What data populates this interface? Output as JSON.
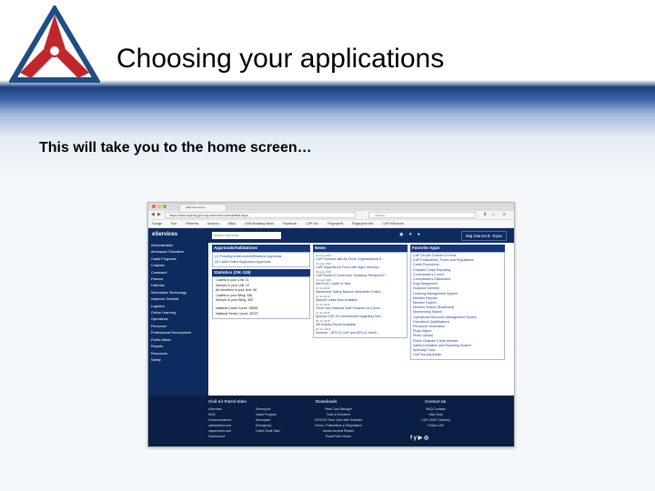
{
  "slide": {
    "title": "Choosing your applications",
    "subtitle": "This will take you to the home screen…"
  },
  "browser": {
    "tab_title": "eServices home",
    "url": "https://www.capnhq.gov/cap.eservices.web/default.aspx",
    "search_placeholder": "Search",
    "bookmarks": [
      "Google",
      "Box",
      "Pinterest",
      "Amazon",
      "eBay",
      "CNN Breaking News",
      "Facebook",
      "CAP Info",
      "Fingerprint",
      "Fingerprint Info",
      "CAP eServices"
    ]
  },
  "header": {
    "brand": "eServices",
    "search_placeholder": "Search eServices",
    "user": "Maj Dianna E. Ryan"
  },
  "sidebar": {
    "items": [
      "Administration",
      "Aerospace Education",
      "Cadet Programs",
      "Chaplain",
      "Command",
      "Finance",
      "Historian",
      "Information Technology",
      "Inspector General",
      "Logistics",
      "Online Learning",
      "Operations",
      "Personnel",
      "Professional Development",
      "Public Affairs",
      "Reports",
      "Resources",
      "Safety"
    ]
  },
  "approvals": {
    "title": "Approvals/Validations",
    "links": [
      "(1) Pending Achievement/Milestone Approvals",
      "(0) Cadet Online Application Approvals"
    ]
  },
  "statistics": {
    "title": "Statistics (OK-115)",
    "lines": [
      "Cadets in your Unit: 21",
      "Seniors in your Unit: 37",
      "All members in your Unit: 58",
      "Cadets in your Wing: 346",
      "Seniors in your Wing: 492"
    ],
    "national": [
      "National Cadet Count: 25835",
      "National Senior Count: 32237"
    ]
  },
  "news": {
    "title": "News",
    "items": [
      {
        "date": "14 Aug 2018",
        "title": "CAP Honored with Air Force Organizational E..."
      },
      {
        "date": "13 Aug 2018",
        "title": "CAP Supports Air Force with flight intercept..."
      },
      {
        "date": "09 Aug 2018",
        "title": "CAP Board of Governors' Guidance Renamed F..."
      },
      {
        "date": "01 Aug 2018",
        "title": "MAYS AC Cadet of Year"
      },
      {
        "date": "31 Jul 2018",
        "title": "September Safety Beacon Newsletter Online..."
      },
      {
        "date": "27 Jul 2018",
        "title": "Special Lease Now Available"
      },
      {
        "date": "19 Jul 2018",
        "title": "Three new National Staff Positions for Devel..."
      },
      {
        "date": "12 Jul 2018",
        "title": "Special CAP 101 Amendment regarding Sea..."
      },
      {
        "date": "05 Jul 2018",
        "title": "NE Activity Report Available"
      },
      {
        "date": "26 Jun 2018",
        "title": "Summer...AFS-21 CAP and AFS-21 Wonk..."
      }
    ]
  },
  "favorites": {
    "title": "Favorite Apps",
    "items": [
      "CAP On-line Charter & Forms",
      "CAP Publications, Forms and Regulations",
      "Cadet Promotions",
      "Chaplain Corps Reporting",
      "Commander's Corner",
      "Commander's Dashboard",
      "Duty Assignment",
      "Inspector General",
      "Learning Management System",
      "Member Reports",
      "Member Search",
      "Member Search (Restricted)",
      "Membership Search",
      "Operational Resource Management System",
      "Operations Qualifications",
      "Personnel Information",
      "Photo Album",
      "Photo Upload",
      "Public Chaplain Corps Website",
      "Safety Education and Reporting System",
      "Specialty Track",
      "Unit Security Admin"
    ]
  },
  "footer": {
    "sites_title": "Civil Air Patrol Sites",
    "sites_a": [
      "eServices",
      "NHQ",
      "Communications",
      "cyberpatriot.com",
      "capservices.com",
      "Governance"
    ],
    "sites_b": [
      "Sharepoint",
      "Cadet Program",
      "Aerospace",
      "Emergency",
      "Cadet Great Start"
    ],
    "downloads_title": "Downloads",
    "downloads": [
      "Fleet Card Manager",
      "Tools & Emblems",
      "CESCSS Time Card Web Software",
      "Forms, Publications & Regulations",
      "Adobe Acrobat Reader",
      "PowerPoint Viewer"
    ],
    "contact_title": "Contact Us",
    "contact": [
      "NHQ Contacts",
      "Help Desk",
      "CAP-USAF Directory",
      "Follow CAP"
    ],
    "social": "f  y  ▶  ◎"
  },
  "colors": {
    "navy": "#0d2b5e",
    "panel_header": "#13357a",
    "link": "#1a3f9c",
    "footer": "#0b1e43",
    "logo_red": "#c0262c",
    "logo_blue": "#1f4d86"
  }
}
